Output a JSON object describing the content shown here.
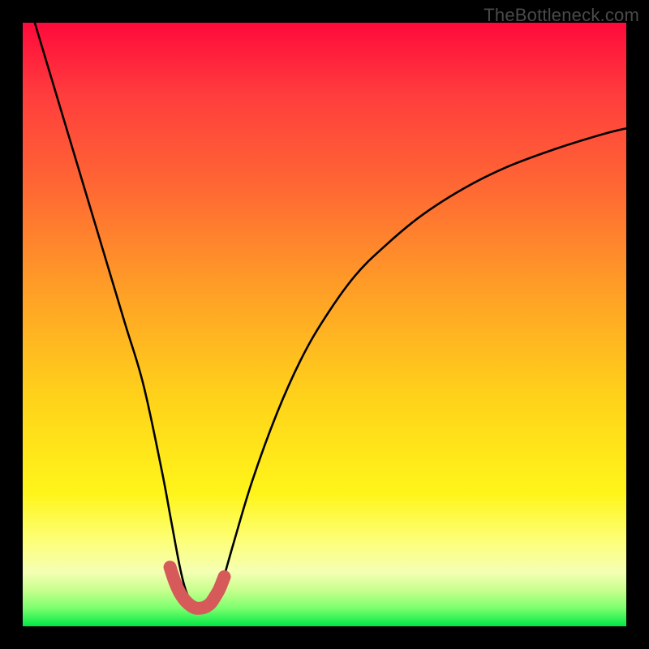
{
  "watermark": "TheBottleneck.com",
  "chart_data": {
    "type": "line",
    "title": "",
    "xlabel": "",
    "ylabel": "",
    "xlim": [
      0,
      100
    ],
    "ylim": [
      0,
      100
    ],
    "series": [
      {
        "name": "bottleneck-curve",
        "x": [
          2,
          5,
          8,
          11,
          14,
          17,
          20,
          23,
          24.5,
          26,
          27,
          28,
          29,
          30,
          31,
          32,
          33,
          35,
          38,
          42,
          46,
          50,
          55,
          60,
          66,
          73,
          80,
          88,
          96,
          100
        ],
        "values": [
          100,
          90,
          80,
          70,
          60,
          50,
          40,
          26,
          18,
          10,
          6,
          4,
          3,
          2.5,
          3,
          4,
          7,
          14,
          24,
          35,
          44,
          51,
          58,
          63,
          68,
          72.5,
          76,
          79,
          81.5,
          82.5
        ]
      },
      {
        "name": "highlight-segment",
        "x": [
          24.4,
          25.2,
          26.0,
          26.8,
          27.6,
          28.2,
          28.8,
          29.4,
          30.0,
          30.6,
          31.2,
          31.8,
          32.6,
          33.4
        ],
        "values": [
          9.8,
          7.4,
          5.6,
          4.4,
          3.6,
          3.2,
          3.0,
          3.0,
          3.1,
          3.4,
          3.9,
          4.8,
          6.2,
          8.2
        ]
      }
    ],
    "highlight_color": "#d65a5a",
    "curve_color": "#000000"
  }
}
